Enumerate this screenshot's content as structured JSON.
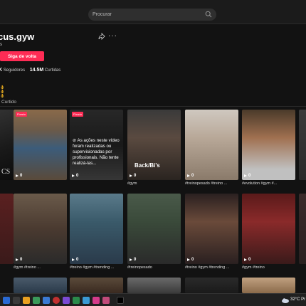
{
  "search": {
    "placeholder": "Procurar"
  },
  "profile": {
    "username": "cus.gyw",
    "nickname": "s",
    "follow_label": "Siga de volta",
    "followers_prefix": "K",
    "followers_label": "Seguidores",
    "likes_value": "14.5M",
    "likes_label": "Curtidas",
    "bio": "👌👌👌"
  },
  "tabs": {
    "liked": "Curtido"
  },
  "cards": [
    {
      "views": "",
      "caption": "",
      "badge": "",
      "side_text": "CS"
    },
    {
      "views": "0",
      "caption": "",
      "badge": "Fixado"
    },
    {
      "views": "0",
      "caption": "",
      "badge": "Fixado",
      "warning": "⊘ As ações neste vídeo foram realizadas ou supervisionadas por profissionais. Não tente realizá-las..."
    },
    {
      "views": "0",
      "caption": "#gym",
      "overlay": "Back/Bi's"
    },
    {
      "views": "0",
      "caption": "#treinopesado #treino ..."
    },
    {
      "views": "0",
      "caption": "#evolution #gym #..."
    },
    {
      "views": "",
      "caption": ""
    },
    {
      "views": "0",
      "caption": "#gym #treino ..."
    },
    {
      "views": "0",
      "caption": "#treino #gym #trending ..."
    },
    {
      "views": "0",
      "caption": "#treinopesado"
    },
    {
      "views": "0",
      "caption": "#treino #gym #trending ..."
    },
    {
      "views": "0",
      "caption": "#gym #treino"
    }
  ],
  "taskbar": {
    "weather": "32°C  Pr"
  },
  "colors": {
    "accent": "#fe2c55",
    "background": "#121212"
  }
}
